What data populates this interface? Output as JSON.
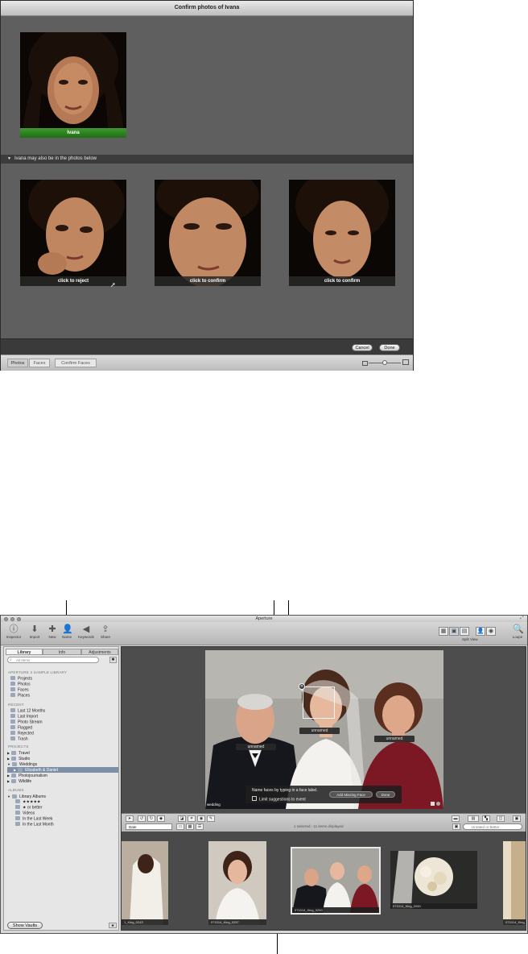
{
  "confirm_window": {
    "title": "Confirm photos of Ivana",
    "confirmed_name": "Ivana",
    "suggest_header": "Ivana may also be in the photos below",
    "suggestions": [
      {
        "label": "click to reject"
      },
      {
        "label": "click to confirm"
      },
      {
        "label": "click to confirm"
      }
    ],
    "cancel_label": "Cancel",
    "done_label": "Done",
    "tabs": [
      "Photos",
      "Faces"
    ],
    "confirm_faces_label": "Confirm Faces"
  },
  "aperture_window": {
    "title": "Aperture",
    "toolbar": {
      "left_tools": [
        {
          "label": "Inspector",
          "icon": "info-icon"
        },
        {
          "label": "Import",
          "icon": "import-arrow-icon"
        },
        {
          "label": "New",
          "icon": "plus-icon"
        },
        {
          "label": "Name",
          "icon": "person-icon"
        },
        {
          "label": "Keywords",
          "icon": "tag-icon"
        },
        {
          "label": "Share",
          "icon": "share-icon"
        }
      ],
      "split_view_label": "Split View",
      "loupe_label": "Loupe"
    },
    "sidebar": {
      "tabs": [
        "Library",
        "Info",
        "Adjustments"
      ],
      "search_placeholder": "All Items",
      "library_header": "APERTURE 3 SAMPLE LIBRARY",
      "library_items": [
        "Projects",
        "Photos",
        "Faces",
        "Places"
      ],
      "recent_header": "RECENT",
      "recent_items": [
        "Last 12 Months",
        "Last Import",
        "Photo Stream",
        "Flagged",
        "Rejected",
        "Trash"
      ],
      "projects_header": "PROJECTS",
      "project_items": [
        "Travel",
        "Studio",
        "Weddings",
        "Elizabeth & Daniel",
        "Photojournalism",
        "Wildlife"
      ],
      "albums_header": "ALBUMS",
      "album_items": [
        "Library Albums",
        "★★★★★",
        "★ or better",
        "Videos",
        "In the Last Week",
        "In the Last Month"
      ],
      "show_vaults_label": "Show Vaults"
    },
    "viewer": {
      "face_labels": [
        "unnamed",
        "unnamed",
        "unnamed"
      ],
      "hint_text": "Name faces by typing in a face label.",
      "add_missing_face_label": "Add Missing Face",
      "hint_done_label": "Done",
      "limit_label": "Limit suggestions to event",
      "photo_caption": "wedding"
    },
    "browser": {
      "sort_value": "Date",
      "status_text": "1 selected - 11 items displayed",
      "filter_placeholder": "Unrated or Better",
      "thumbs": [
        {
          "caption": "1_King_0243"
        },
        {
          "caption": "071014_King_0257"
        },
        {
          "caption": "071014_King_0250"
        },
        {
          "caption": "071014_King_0260"
        },
        {
          "caption": "071014_King_0"
        }
      ]
    }
  },
  "colors": {
    "name_bar_green": "#2f8a22",
    "selection_blue": "#7d8fa7",
    "dark_panel": "#4d4d4d"
  }
}
